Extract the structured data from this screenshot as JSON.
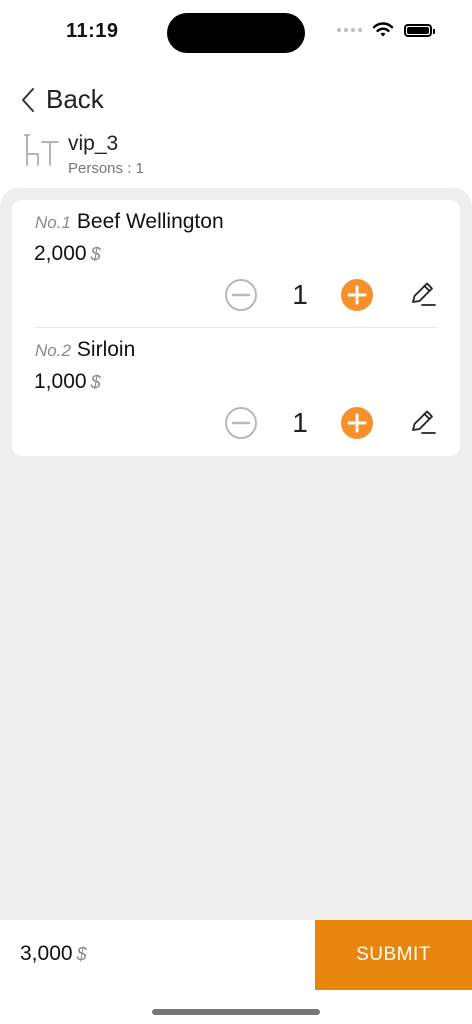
{
  "status_bar": {
    "time": "11:19"
  },
  "nav": {
    "back_label": "Back"
  },
  "table": {
    "name": "vip_3",
    "persons_label": "Persons : 1"
  },
  "order": {
    "items": [
      {
        "no": "No.1",
        "name": "Beef Wellington",
        "price": "2,000",
        "currency": "$",
        "quantity": "1"
      },
      {
        "no": "No.2",
        "name": "Sirloin",
        "price": "1,000",
        "currency": "$",
        "quantity": "1"
      }
    ]
  },
  "footer": {
    "total": "3,000",
    "currency": "$",
    "submit_label": "SUBMIT"
  },
  "colors": {
    "accent": "#e8850d",
    "plus_button": "#f5902a",
    "background": "#efefef"
  },
  "icons": [
    "back-chevron-icon",
    "chair-table-icon",
    "minus-circle-icon",
    "plus-circle-icon",
    "edit-pencil-icon",
    "wifi-icon",
    "battery-icon",
    "signal-icon"
  ]
}
